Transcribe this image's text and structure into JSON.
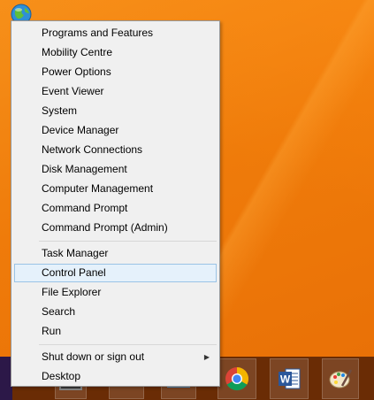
{
  "menu": {
    "group1": [
      {
        "label": "Programs and Features"
      },
      {
        "label": "Mobility Centre"
      },
      {
        "label": "Power Options"
      },
      {
        "label": "Event Viewer"
      },
      {
        "label": "System"
      },
      {
        "label": "Device Manager"
      },
      {
        "label": "Network Connections"
      },
      {
        "label": "Disk Management"
      },
      {
        "label": "Computer Management"
      },
      {
        "label": "Command Prompt"
      },
      {
        "label": "Command Prompt (Admin)"
      }
    ],
    "group2": [
      {
        "label": "Task Manager"
      },
      {
        "label": "Control Panel"
      },
      {
        "label": "File Explorer"
      },
      {
        "label": "Search"
      },
      {
        "label": "Run"
      }
    ],
    "group3": [
      {
        "label": "Shut down or sign out",
        "submenu_arrow": "▶"
      },
      {
        "label": "Desktop"
      }
    ],
    "highlighted": "Control Panel"
  },
  "taskbar": {
    "apps": [
      "chrome-icon",
      "word-icon",
      "paint-icon"
    ],
    "word_letter": "W"
  },
  "colors": {
    "desktop_orange": "#f07d0c",
    "taskbar": "#6a2c05",
    "menu_bg": "#f0f0f0",
    "hover_bg": "#e5f1fb",
    "hover_border": "#9ac3e6",
    "word_blue": "#2b579a"
  }
}
